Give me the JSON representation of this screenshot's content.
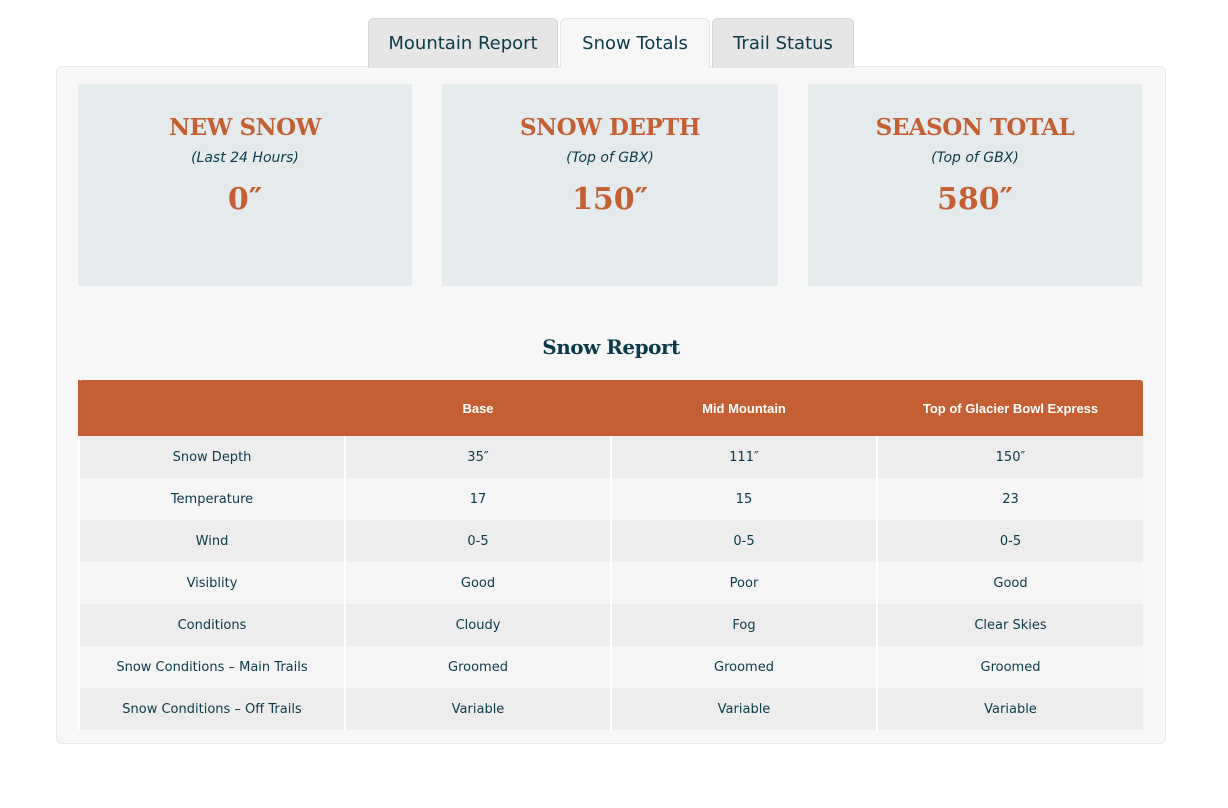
{
  "tabs": [
    {
      "label": "Mountain Report",
      "active": false
    },
    {
      "label": "Snow Totals",
      "active": true
    },
    {
      "label": "Trail Status",
      "active": false
    }
  ],
  "cards": [
    {
      "title": "NEW SNOW",
      "subtitle": "(Last 24 Hours)",
      "value": "0″"
    },
    {
      "title": "SNOW DEPTH",
      "subtitle": "(Top of GBX)",
      "value": "150″"
    },
    {
      "title": "SEASON TOTAL",
      "subtitle": "(Top of GBX)",
      "value": "580″"
    }
  ],
  "report": {
    "title": "Snow Report",
    "headers": [
      "",
      "Base",
      "Mid Mountain",
      "Top of Glacier Bowl Express"
    ],
    "rows": [
      [
        "Snow Depth",
        "35″",
        "111″",
        "150″"
      ],
      [
        "Temperature",
        "17",
        "15",
        "23"
      ],
      [
        "Wind",
        "0-5",
        "0-5",
        "0-5"
      ],
      [
        "Visiblity",
        "Good",
        "Poor",
        "Good"
      ],
      [
        "Conditions",
        "Cloudy",
        "Fog",
        "Clear Skies"
      ],
      [
        "Snow Conditions – Main Trails",
        "Groomed",
        "Groomed",
        "Groomed"
      ],
      [
        "Snow Conditions – Off Trails",
        "Variable",
        "Variable",
        "Variable"
      ]
    ]
  },
  "colors": {
    "accent": "#c45f34",
    "text": "#0b3a4a",
    "card_bg": "#e5ebed"
  }
}
